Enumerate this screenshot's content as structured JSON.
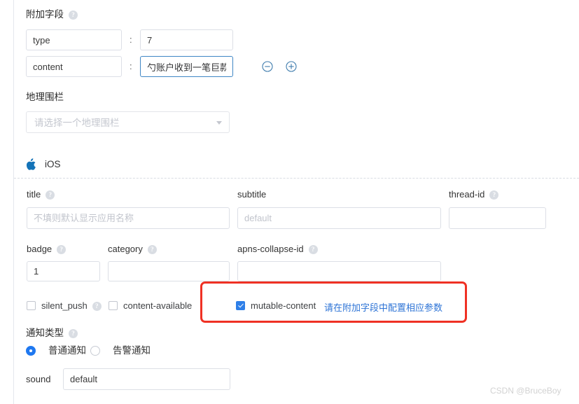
{
  "sections": {
    "extra_fields": {
      "title": "附加字段",
      "help_glyph": "?",
      "rows": [
        {
          "key": "type",
          "separator": ":",
          "value": "7"
        },
        {
          "key": "content",
          "separator": ":",
          "value": "勺账户收到一笔巨款"
        }
      ],
      "remove_icon": "circle-minus-icon",
      "add_icon": "circle-plus-icon"
    },
    "geofence": {
      "title": "地理围栏",
      "placeholder": "请选择一个地理围栏",
      "caret_icon": "chevron-down-icon"
    },
    "ios": {
      "platform_label": "iOS",
      "apple_icon": "apple-icon",
      "fields": [
        {
          "label": "title",
          "has_help": true,
          "value": "",
          "placeholder": "不填则默认显示应用名称"
        },
        {
          "label": "subtitle",
          "has_help": false,
          "value": "",
          "placeholder": "default"
        },
        {
          "label": "thread-id",
          "has_help": true,
          "value": "",
          "placeholder": ""
        },
        {
          "label": "badge",
          "has_help": true,
          "value": "1",
          "placeholder": ""
        },
        {
          "label": "category",
          "has_help": true,
          "value": "",
          "placeholder": ""
        },
        {
          "label": "apns-collapse-id",
          "has_help": true,
          "value": "",
          "placeholder": ""
        }
      ],
      "checkboxes": [
        {
          "label": "silent_push",
          "checked": false,
          "has_help": true
        },
        {
          "label": "content-available",
          "checked": false,
          "has_help": false
        },
        {
          "label": "mutable-content",
          "checked": true,
          "has_help": false
        }
      ],
      "mutable_hint": "请在附加字段中配置相应参数"
    },
    "notify_type": {
      "title": "通知类型",
      "options": [
        {
          "label": "普通通知",
          "selected": true
        },
        {
          "label": "告警通知",
          "selected": false
        }
      ],
      "sound_label": "sound",
      "sound_value": "default"
    }
  },
  "annotation": {
    "color": "#ef3124",
    "name": "red-highlight-box"
  },
  "watermark": "CSDN @BruceBoy",
  "colors": {
    "accent_blue": "#2e7fe8",
    "link_blue": "#2e74d6",
    "focus_border": "#3f86c5",
    "apple_blue": "#1473b8"
  }
}
